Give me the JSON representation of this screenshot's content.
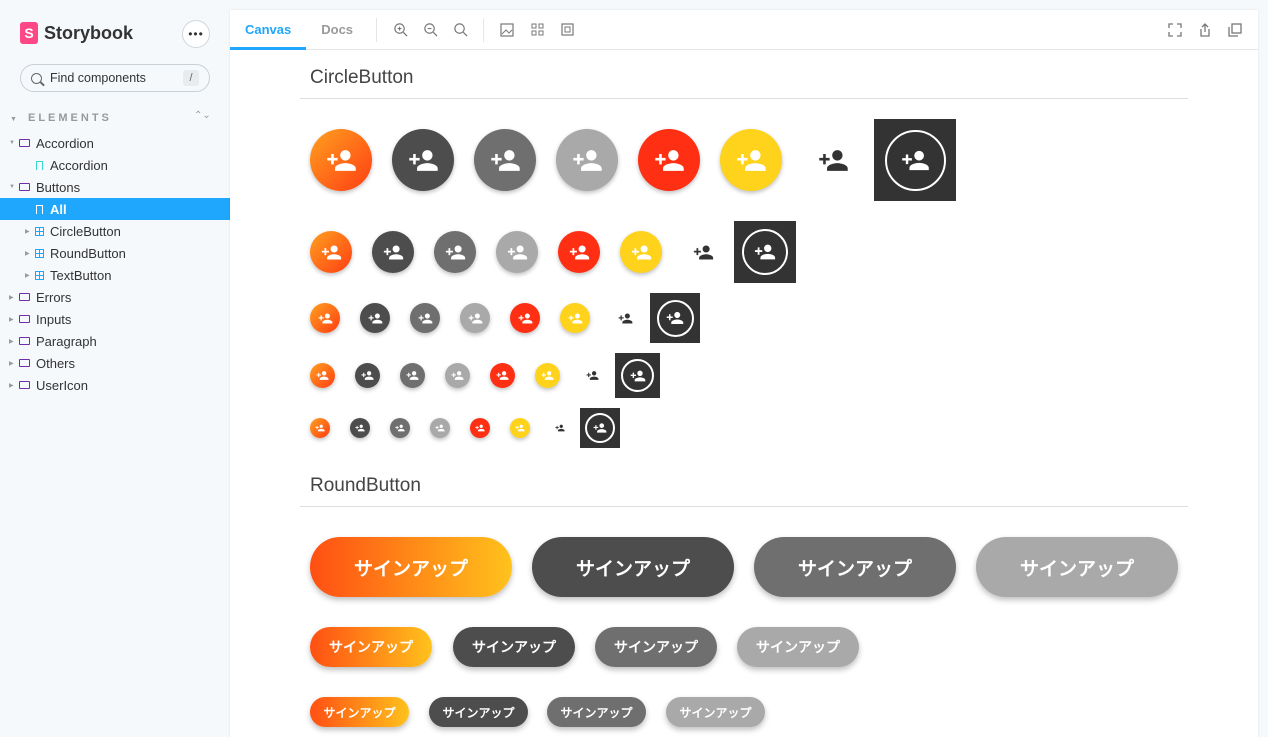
{
  "brand": {
    "name": "Storybook",
    "logo_letter": "S",
    "menu": "•••"
  },
  "search": {
    "placeholder": "Find components",
    "shortcut": "/"
  },
  "sidebar": {
    "section_title": "ELEMENTS",
    "items": [
      {
        "label": "Accordion",
        "type": "folder"
      },
      {
        "label": "Accordion",
        "type": "story"
      },
      {
        "label": "Buttons",
        "type": "folder"
      },
      {
        "label": "All",
        "type": "story",
        "selected": true
      },
      {
        "label": "CircleButton",
        "type": "component"
      },
      {
        "label": "RoundButton",
        "type": "component"
      },
      {
        "label": "TextButton",
        "type": "component"
      },
      {
        "label": "Errors",
        "type": "folder"
      },
      {
        "label": "Inputs",
        "type": "folder"
      },
      {
        "label": "Paragraph",
        "type": "folder"
      },
      {
        "label": "Others",
        "type": "folder"
      },
      {
        "label": "UserIcon",
        "type": "folder"
      }
    ]
  },
  "toolbar": {
    "tabs": [
      {
        "label": "Canvas",
        "active": true
      },
      {
        "label": "Docs"
      }
    ],
    "tools": [
      "zoom-in-icon",
      "zoom-out-icon",
      "reset-zoom-icon",
      "background-icon",
      "grid-icon",
      "outline-icon"
    ],
    "right_tools": [
      "fullscreen-icon",
      "share-icon",
      "copy-icon"
    ]
  },
  "canvas": {
    "circle_heading": "CircleButton",
    "round_heading": "RoundButton",
    "round_label": "サインアップ",
    "colors": {
      "accent": "#1ea7fd",
      "orange": "#ff3d13",
      "yellow": "#ffd21c",
      "dark": "#4d4d4d",
      "mid": "#6f6f6f",
      "light": "#a9a9a9",
      "red": "#ff2f13"
    }
  }
}
